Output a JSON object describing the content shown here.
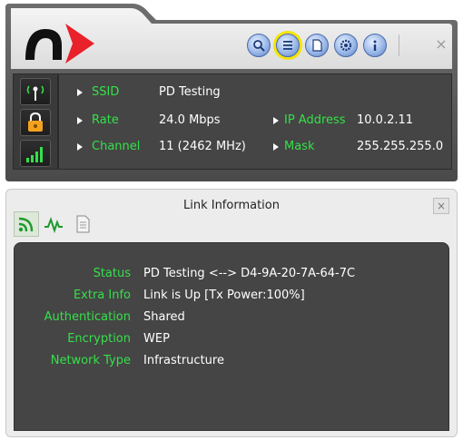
{
  "toolbar": {
    "buttons": [
      {
        "name": "search",
        "icon": "magnifier-icon"
      },
      {
        "name": "link-info",
        "icon": "list-icon",
        "highlighted": true
      },
      {
        "name": "page",
        "icon": "page-icon"
      },
      {
        "name": "settings",
        "icon": "gear-icon"
      },
      {
        "name": "about",
        "icon": "info-icon"
      }
    ],
    "close_label": "×"
  },
  "status": {
    "ssid_label": "SSID",
    "ssid_value": "PD Testing",
    "rate_label": "Rate",
    "rate_value": "24.0 Mbps",
    "channel_label": "Channel",
    "channel_value": "11 (2462 MHz)",
    "ip_label": "IP Address",
    "ip_value": "10.0.2.11",
    "mask_label": "Mask",
    "mask_value": "255.255.255.0"
  },
  "link_window": {
    "title": "Link Information",
    "close_label": "×",
    "tabs": [
      {
        "name": "link",
        "icon": "wifi-icon",
        "selected": true
      },
      {
        "name": "signal",
        "icon": "pulse-icon",
        "selected": false
      },
      {
        "name": "details",
        "icon": "document-icon",
        "selected": false
      }
    ],
    "rows": [
      {
        "label": "Status",
        "value": "PD Testing <--> D4-9A-20-7A-64-7C"
      },
      {
        "label": "Extra Info",
        "value": "Link is Up  [Tx Power:100%]"
      },
      {
        "label": "Authentication",
        "value": "Shared"
      },
      {
        "label": "Encryption",
        "value": "WEP"
      },
      {
        "label": "Network Type",
        "value": "Infrastructure"
      }
    ]
  },
  "colors": {
    "accent_green": "#35e04a",
    "panel_dark": "#454545",
    "logo_red": "#e8212a",
    "highlight_yellow": "#f5e400"
  }
}
